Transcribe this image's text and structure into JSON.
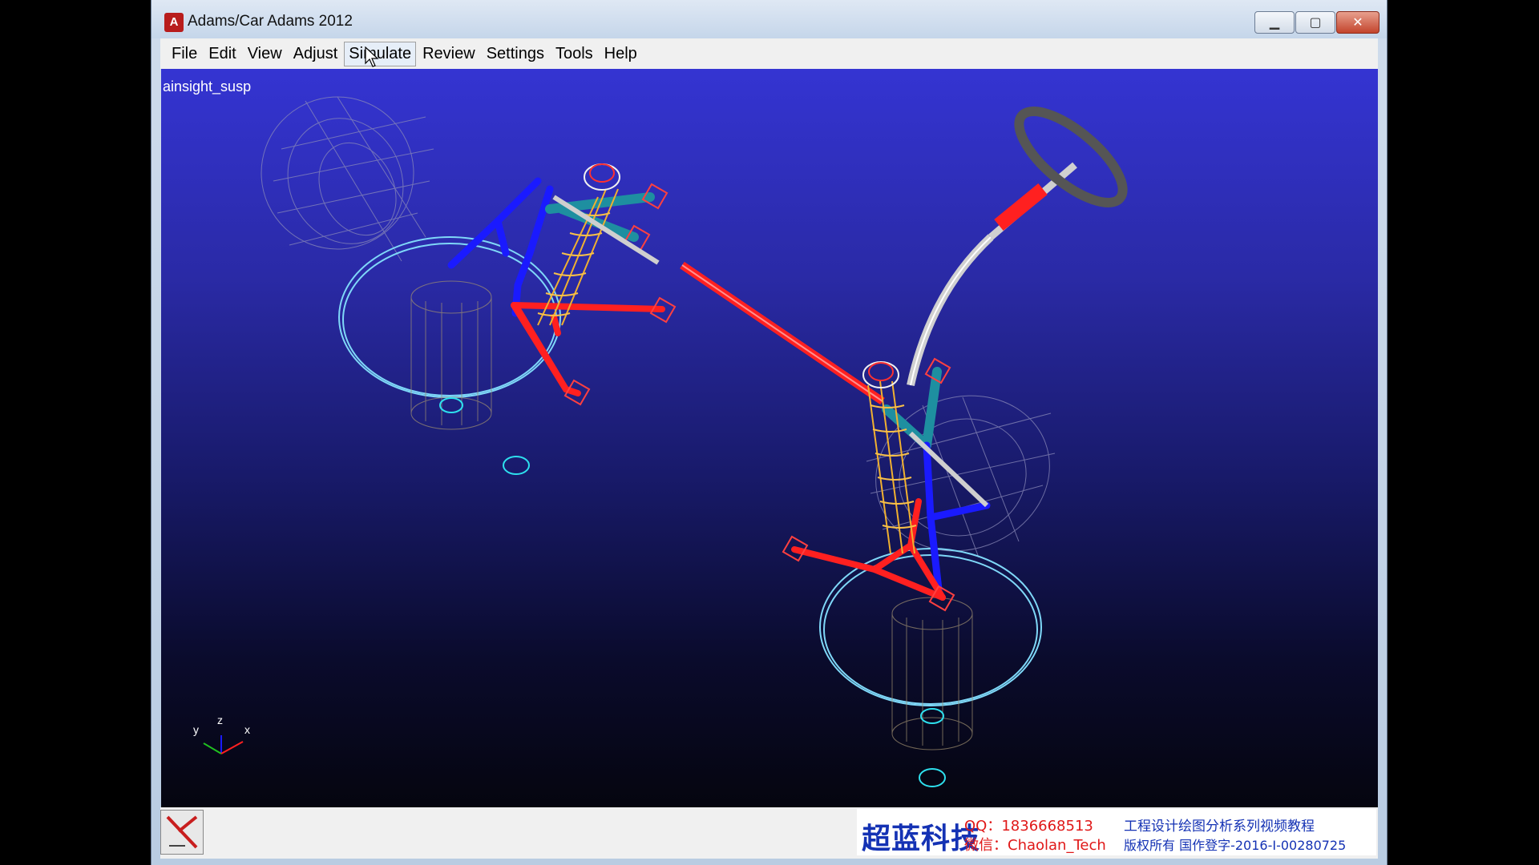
{
  "window": {
    "title": "Adams/Car Adams 2012",
    "app_icon_letter": "A"
  },
  "menu": {
    "items": [
      {
        "label": "File"
      },
      {
        "label": "Edit"
      },
      {
        "label": "View"
      },
      {
        "label": "Adjust"
      },
      {
        "label": "Simulate"
      },
      {
        "label": "Review"
      },
      {
        "label": "Settings"
      },
      {
        "label": "Tools"
      },
      {
        "label": "Help"
      }
    ]
  },
  "viewport": {
    "model_name": "ainsight_susp",
    "triad": {
      "x": "x",
      "y": "y",
      "z": "z"
    },
    "background_top": "#3434d2",
    "background_bottom": "#05050f"
  },
  "watermark": {
    "brand": "超蓝科技",
    "qq": "QQ：1836668513",
    "wechat": "微信：Chaolan_Tech",
    "series": "工程设计绘图分析系列视频教程",
    "copyright": "版权所有  国作登字-2016-I-00280725"
  },
  "colors": {
    "red_parts": "#ff2020",
    "blue_parts": "#1a1aff",
    "teal_parts": "#1e8fa0",
    "spring": "#f0b030",
    "wheel_ring": "#7fd8f8",
    "steering_wheel": "#555555"
  }
}
